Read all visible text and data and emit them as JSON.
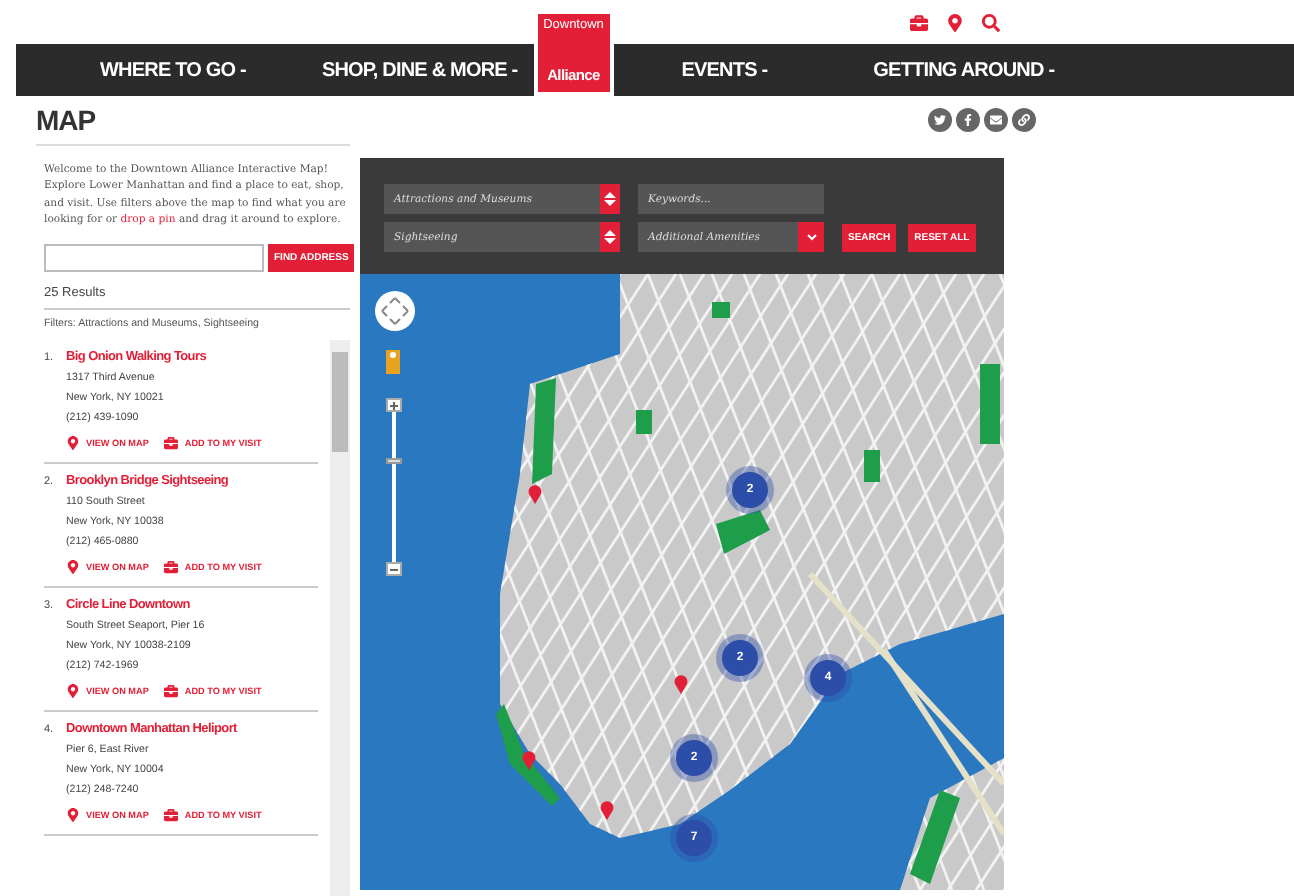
{
  "nav": {
    "items": [
      "WHERE TO GO -",
      "SHOP, DINE & MORE -",
      "EVENTS -",
      "GETTING AROUND -"
    ],
    "logo": {
      "top": "Downtown",
      "bottom": "Alliance"
    }
  },
  "page_title": "MAP",
  "intro": {
    "before": "Welcome to the Downtown Alliance Interactive Map! Explore Lower Manhattan and find a place to eat, shop, and visit. Use filters above the map to find what you are looking for or ",
    "link": "drop a pin",
    "after": " and drag it around to explore."
  },
  "address_search": {
    "button": "FIND ADDRESS"
  },
  "results_count": "25 Results",
  "filters_text": "Filters: Attractions and Museums, Sightseeing",
  "results": [
    {
      "number": "1.",
      "name": "Big Onion Walking Tours",
      "lines": [
        "1317 Third Avenue",
        "New York, NY 10021",
        "(212) 439-1090"
      ],
      "view": "VIEW ON MAP",
      "add": "ADD TO MY VISIT"
    },
    {
      "number": "2.",
      "name": "Brooklyn Bridge Sightseeing",
      "lines": [
        "110 South Street",
        "New York, NY 10038",
        "(212) 465-0880"
      ],
      "view": "VIEW ON MAP",
      "add": "ADD TO MY VISIT"
    },
    {
      "number": "3.",
      "name": "Circle Line Downtown",
      "lines": [
        "South Street Seaport, Pier 16",
        "New York, NY 10038-2109",
        "(212) 742-1969"
      ],
      "view": "VIEW ON MAP",
      "add": "ADD TO MY VISIT"
    },
    {
      "number": "4.",
      "name": "Downtown Manhattan Heliport",
      "lines": [
        "Pier 6, East River",
        "New York, NY 10004",
        "(212) 248-7240"
      ],
      "view": "VIEW ON MAP",
      "add": "ADD TO MY VISIT"
    }
  ],
  "map_filters": {
    "category": "Attractions and Museums",
    "keywords_placeholder": "Keywords...",
    "subcategory": "Sightseeing",
    "amenities": "Additional Amenities",
    "search_button": "SEARCH",
    "reset_button": "RESET ALL"
  },
  "map": {
    "zoom": {
      "level": 0.69
    },
    "clusters": [
      "2",
      "2",
      "4",
      "2",
      "7"
    ]
  }
}
